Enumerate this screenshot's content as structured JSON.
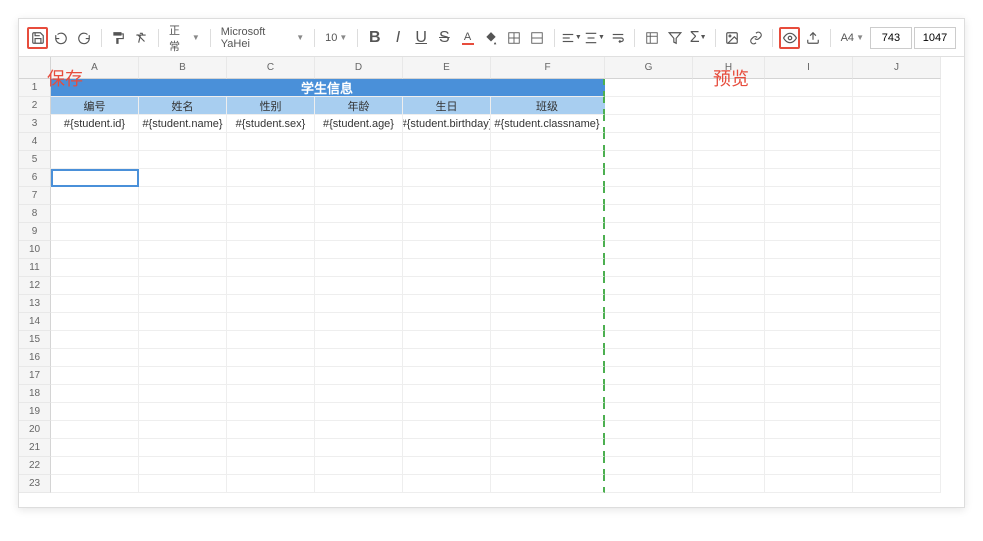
{
  "toolbar": {
    "style_select": "正常",
    "font_select": "Microsoft YaHei",
    "size_select": "10",
    "page_size": "A4",
    "input1": "743",
    "input2": "1047"
  },
  "annotations": {
    "save": "保存",
    "preview": "预览"
  },
  "columns": [
    "A",
    "B",
    "C",
    "D",
    "E",
    "F",
    "G",
    "H",
    "I",
    "J"
  ],
  "row_count": 23,
  "sheet": {
    "title": "学生信息",
    "headers": [
      "编号",
      "姓名",
      "性别",
      "年龄",
      "生日",
      "班级"
    ],
    "row3": [
      "#{student.id}",
      "#{student.name}",
      "#{student.sex}",
      "#{student.age}",
      "#{student.birthday}",
      "#{student.classname}"
    ]
  }
}
